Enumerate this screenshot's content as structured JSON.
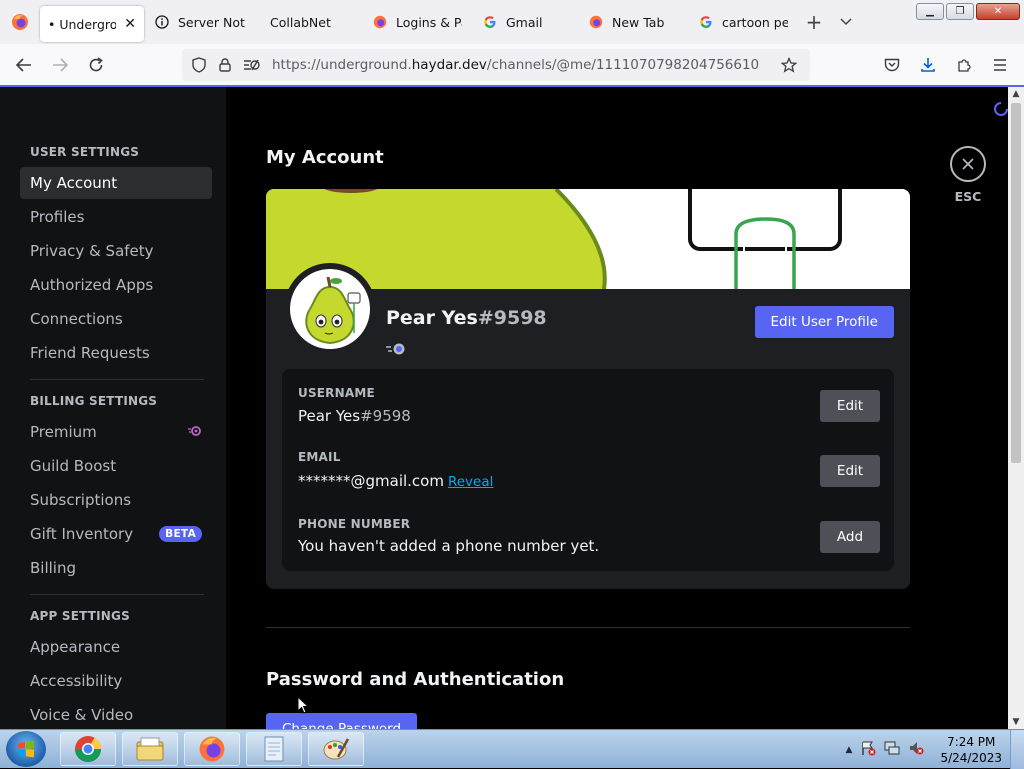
{
  "browser": {
    "tabs": [
      {
        "label": "• Undergroun",
        "icon": "firefox-icon",
        "active": true
      },
      {
        "label": "Server Not F",
        "icon": "info-icon"
      },
      {
        "label": "CollabNet",
        "icon": "none"
      },
      {
        "label": "Logins & Pa",
        "icon": "firefox-icon"
      },
      {
        "label": "Gmail",
        "icon": "google-icon"
      },
      {
        "label": "New Tab",
        "icon": "firefox-icon"
      },
      {
        "label": "cartoon pea",
        "icon": "google-icon"
      }
    ],
    "url_prefix": "https://underground.",
    "url_host": "haydar.dev",
    "url_path": "/channels/@me/1111070798204756610"
  },
  "sidebar": {
    "user_settings_header": "USER SETTINGS",
    "user_items": [
      "My Account",
      "Profiles",
      "Privacy & Safety",
      "Authorized Apps",
      "Connections",
      "Friend Requests"
    ],
    "billing_settings_header": "BILLING SETTINGS",
    "billing_items": [
      "Premium",
      "Guild Boost",
      "Subscriptions",
      "Gift Inventory",
      "Billing"
    ],
    "beta_badge": "BETA",
    "app_settings_header": "APP SETTINGS",
    "app_items": [
      "Appearance",
      "Accessibility",
      "Voice & Video"
    ]
  },
  "content": {
    "page_title": "My Account",
    "display_name": "Pear Yes",
    "discriminator": "#9598",
    "edit_profile_label": "Edit User Profile",
    "username_label": "USERNAME",
    "username_name": "Pear Yes",
    "username_disc": "#9598",
    "username_btn": "Edit",
    "email_label": "EMAIL",
    "email_value": "*******@gmail.com",
    "email_reveal": "Reveal",
    "email_btn": "Edit",
    "phone_label": "PHONE NUMBER",
    "phone_value": "You haven't added a phone number yet.",
    "phone_btn": "Add",
    "password_section_title": "Password and Authentication",
    "change_password_label": "Change Password",
    "esc_label": "ESC"
  },
  "taskbar": {
    "time": "7:24 PM",
    "date": "5/24/2023"
  },
  "colors": {
    "blurple": "#5865f2",
    "sidebar_bg": "#111214",
    "card_bg": "#1e1f22",
    "link": "#00a8fc",
    "banner_green": "#c5d82e"
  }
}
